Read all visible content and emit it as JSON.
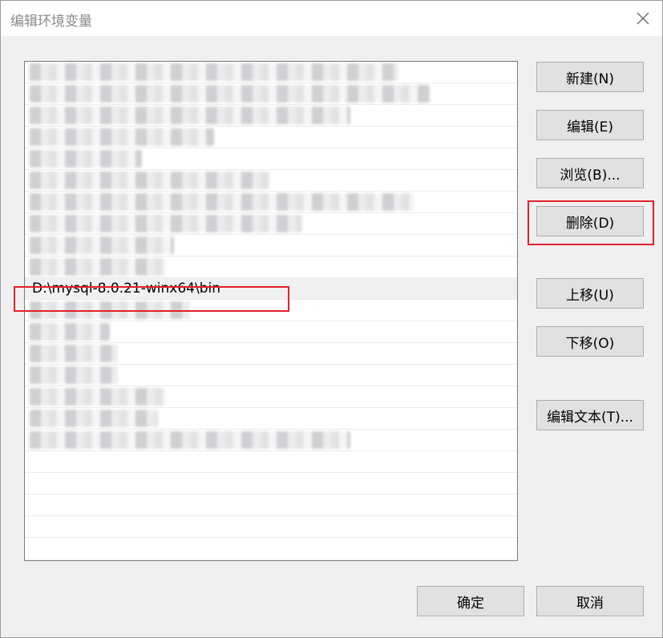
{
  "dialog": {
    "title": "编辑环境变量"
  },
  "icons": {
    "close": "close-icon"
  },
  "path_list": {
    "rows": [
      {
        "text": "",
        "obscured": true,
        "blur_width": 460
      },
      {
        "text": "",
        "obscured": true,
        "blur_width": 500
      },
      {
        "text": "",
        "obscured": true,
        "blur_width": 400
      },
      {
        "text": "",
        "obscured": true,
        "blur_width": 230
      },
      {
        "text": "",
        "obscured": true,
        "blur_width": 140
      },
      {
        "text": "",
        "obscured": true,
        "blur_width": 300
      },
      {
        "text": "",
        "obscured": true,
        "blur_width": 480
      },
      {
        "text": "",
        "obscured": true,
        "blur_width": 340
      },
      {
        "text": "",
        "obscured": true,
        "blur_width": 180
      },
      {
        "text": "",
        "obscured": true,
        "blur_width": 170
      },
      {
        "text": "D:\\mysql-8.0.21-winx64\\bin",
        "obscured": false,
        "selected": true
      },
      {
        "text": "",
        "obscured": true,
        "blur_width": 200
      },
      {
        "text": "",
        "obscured": true,
        "blur_width": 100
      },
      {
        "text": "",
        "obscured": true,
        "blur_width": 110
      },
      {
        "text": "",
        "obscured": true,
        "blur_width": 110
      },
      {
        "text": "",
        "obscured": true,
        "blur_width": 170
      },
      {
        "text": "",
        "obscured": true,
        "blur_width": 160
      },
      {
        "text": "",
        "obscured": true,
        "blur_width": 400
      },
      {
        "text": "",
        "obscured": false
      },
      {
        "text": "",
        "obscured": false
      },
      {
        "text": "",
        "obscured": false
      },
      {
        "text": "",
        "obscured": false
      },
      {
        "text": "",
        "obscured": false
      }
    ]
  },
  "buttons": {
    "new": "新建(N)",
    "edit": "编辑(E)",
    "browse": "浏览(B)...",
    "delete": "删除(D)",
    "move_up": "上移(U)",
    "move_down": "下移(O)",
    "edit_text": "编辑文本(T)...",
    "ok": "确定",
    "cancel": "取消"
  },
  "colors": {
    "annotation_red": "#e0212b",
    "button_bg": "#e1e1e1",
    "dialog_bg": "#f0f0f0"
  }
}
